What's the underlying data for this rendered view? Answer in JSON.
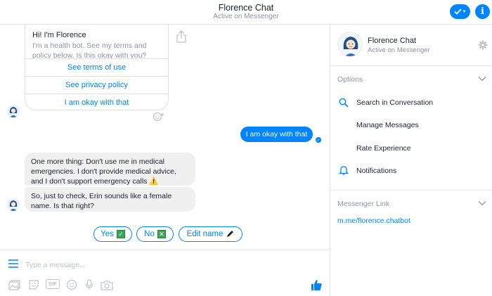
{
  "header": {
    "title": "Florence Chat",
    "subtitle": "Active on Messenger"
  },
  "card": {
    "title": "Hi! I'm Florence",
    "text": "I'm a health bot. See my terms and policy below. Is this okay with you?",
    "buttons": [
      "See terms of use",
      "See privacy policy",
      "I am okay with that"
    ]
  },
  "messages": {
    "user_reply": "I am okay with that",
    "bot_1": "One more thing: Don't use me in medical emergencies. I don't provide medical advice, and I don't support emergency calls ⚠️",
    "bot_2": "So, just to check, Erin sounds like a female name. Is that right?"
  },
  "quick_replies": {
    "yes": "Yes",
    "no": "No",
    "edit": "Edit name"
  },
  "composer": {
    "placeholder": "Type a message..."
  },
  "sidebar": {
    "name": "Florence Chat",
    "status": "Active on Messenger",
    "options_title": "Options",
    "items": [
      "Search in Conversation",
      "Manage Messages",
      "Rate Experience",
      "Notifications"
    ],
    "link_title": "Messenger Link",
    "link": "m.me/florence.chatbot"
  },
  "colors": {
    "accent": "#0084ff",
    "bubble_gray": "#f1f0f0",
    "muted_text": "#90949c"
  }
}
